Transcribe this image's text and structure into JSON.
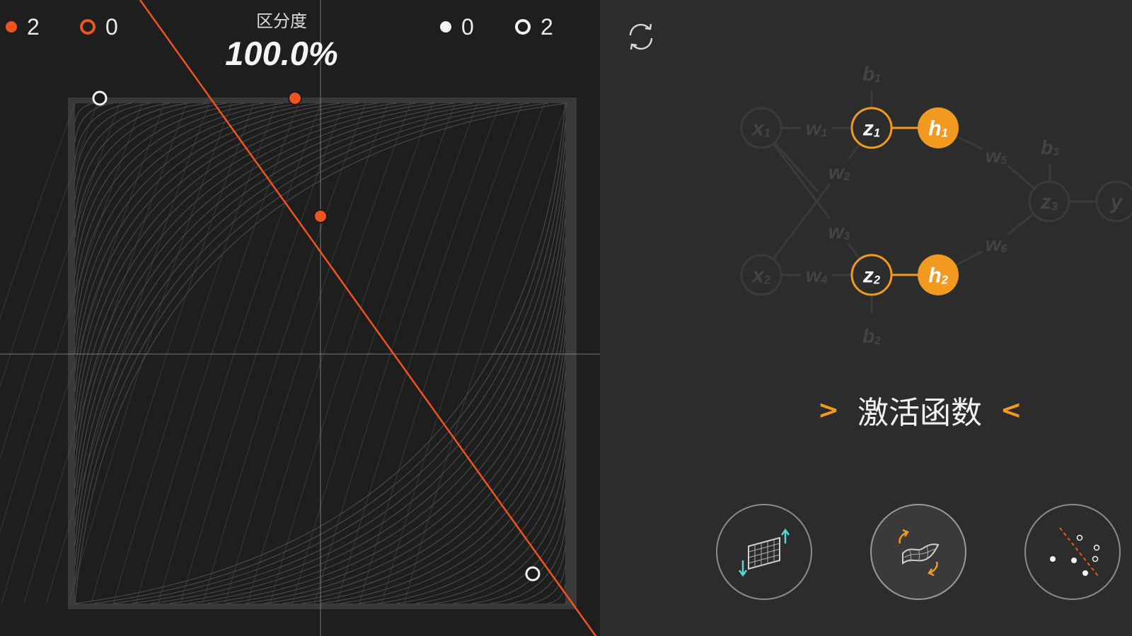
{
  "legend": {
    "orange_filled_count": "2",
    "orange_hollow_count": "0",
    "white_filled_count": "0",
    "white_hollow_count": "2"
  },
  "accuracy": {
    "label": "区分度",
    "value": "100.0%"
  },
  "network": {
    "inputs": [
      {
        "name": "x-1",
        "base": "x",
        "sub": "1"
      },
      {
        "name": "x-2",
        "base": "x",
        "sub": "2"
      }
    ],
    "weights": [
      {
        "name": "w-1",
        "base": "w",
        "sub": "1"
      },
      {
        "name": "w-2",
        "base": "w",
        "sub": "2"
      },
      {
        "name": "w-3",
        "base": "w",
        "sub": "3"
      },
      {
        "name": "w-4",
        "base": "w",
        "sub": "4"
      },
      {
        "name": "w-5",
        "base": "w",
        "sub": "5"
      },
      {
        "name": "w-6",
        "base": "w",
        "sub": "6"
      }
    ],
    "biases": [
      {
        "name": "b-1",
        "base": "b",
        "sub": "1"
      },
      {
        "name": "b-2",
        "base": "b",
        "sub": "2"
      },
      {
        "name": "b-3",
        "base": "b",
        "sub": "3"
      }
    ],
    "z_nodes": [
      {
        "name": "z-1",
        "base": "z",
        "sub": "1"
      },
      {
        "name": "z-2",
        "base": "z",
        "sub": "2"
      },
      {
        "name": "z-3",
        "base": "z",
        "sub": "3"
      }
    ],
    "h_nodes": [
      {
        "name": "h-1",
        "base": "h",
        "sub": "1"
      },
      {
        "name": "h-2",
        "base": "h",
        "sub": "2"
      }
    ],
    "output": {
      "name": "y",
      "base": "y",
      "sub": ""
    }
  },
  "section": {
    "title": "激活函数",
    "prev_arrow": ">",
    "next_arrow": "<"
  },
  "icons": {
    "refresh": "refresh-icon",
    "linear_transform": "linear-transform-icon",
    "activation_warp": "activation-warp-icon",
    "classification": "classification-icon"
  },
  "colors": {
    "accent_orange": "#f29a1f",
    "point_orange": "#f0541e",
    "boundary_line": "#f0541e",
    "plot_background": "#1e1e1e",
    "panel_background": "#2c2c2c",
    "dim_node": "#3b3b3b"
  }
}
